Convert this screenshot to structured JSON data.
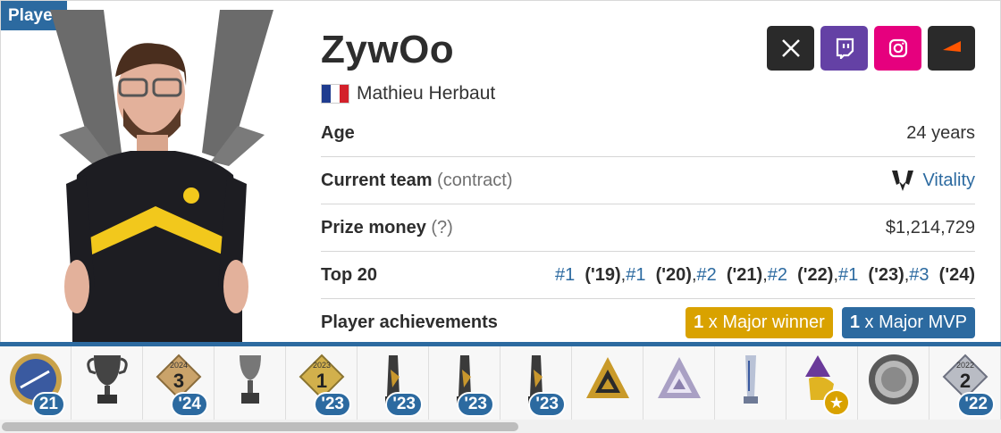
{
  "tag": "Player",
  "nickname": "ZywOo",
  "real_name": "Mathieu Herbaut",
  "socials": [
    {
      "name": "x",
      "color": "#2a2a2a"
    },
    {
      "name": "twitch",
      "color": "#6441a5"
    },
    {
      "name": "instagram",
      "color": "#e6007e"
    },
    {
      "name": "faceit",
      "color": "#2a2a2a"
    }
  ],
  "info": {
    "age_label": "Age",
    "age_value": "24 years",
    "team_label": "Current team",
    "team_sub": "(contract)",
    "team_value": "Vitality",
    "prize_label": "Prize money",
    "prize_sub": "(?)",
    "prize_value": "$1,214,729",
    "top20_label": "Top 20",
    "top20": [
      {
        "rank": "#1",
        "year": "('19)"
      },
      {
        "rank": "#1",
        "year": "('20)"
      },
      {
        "rank": "#2",
        "year": "('21)"
      },
      {
        "rank": "#2",
        "year": "('22)"
      },
      {
        "rank": "#1",
        "year": "('23)"
      },
      {
        "rank": "#3",
        "year": "('24)"
      }
    ],
    "ach_label": "Player achievements",
    "major_winner": {
      "count": "1",
      "text": " x Major winner"
    },
    "major_mvp": {
      "count": "1",
      "text": " x Major MVP"
    }
  },
  "achievements": [
    {
      "icon": "coin-icon",
      "badge": "21"
    },
    {
      "icon": "trophy-icon",
      "badge": ""
    },
    {
      "icon": "rank-3-icon",
      "badge": "'24",
      "top": "2024",
      "num": "3"
    },
    {
      "icon": "cup-icon",
      "badge": ""
    },
    {
      "icon": "rank-1-icon",
      "badge": "'23",
      "top": "2023",
      "num": "1"
    },
    {
      "icon": "statue-icon",
      "badge": "'23"
    },
    {
      "icon": "statue-icon",
      "badge": "'23"
    },
    {
      "icon": "statue-icon",
      "badge": "'23"
    },
    {
      "icon": "blast-gold-icon",
      "badge": ""
    },
    {
      "icon": "blast-silver-icon",
      "badge": ""
    },
    {
      "icon": "pillar-icon",
      "badge": ""
    },
    {
      "icon": "mvp-star-icon",
      "badge": "star"
    },
    {
      "icon": "medal-icon",
      "badge": ""
    },
    {
      "icon": "rank-2-icon",
      "badge": "'22",
      "top": "2022",
      "num": "2"
    }
  ]
}
